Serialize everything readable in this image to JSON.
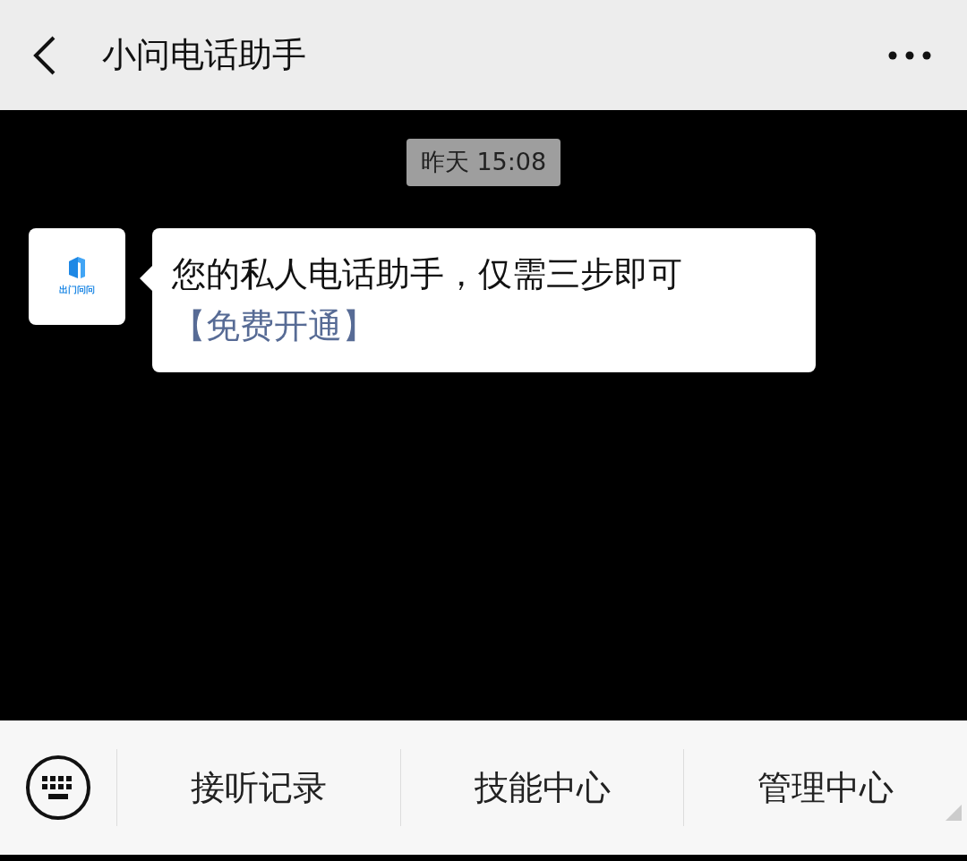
{
  "header": {
    "title": "小问电话助手"
  },
  "messages": [
    {
      "kind": "time",
      "text": "昨天 15:08"
    },
    {
      "kind": "bubble",
      "avatar_logo": "出门问问",
      "text": "您的私人电话助手，仅需三步即可",
      "link": "【免费开通】"
    }
  ],
  "menu": [
    {
      "label": "接听记录",
      "submenu": false
    },
    {
      "label": "技能中心",
      "submenu": false
    },
    {
      "label": "管理中心",
      "submenu": true
    }
  ]
}
